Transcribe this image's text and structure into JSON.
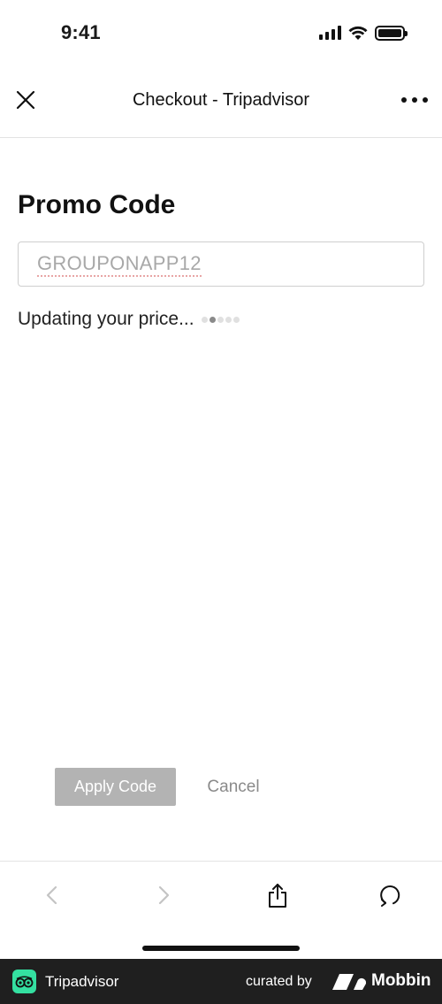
{
  "status_bar": {
    "time": "9:41"
  },
  "header": {
    "title": "Checkout - Tripadvisor"
  },
  "main": {
    "title": "Promo Code",
    "promo_input": {
      "value": "GROUPONAPP12"
    },
    "status_text": "Updating your price..."
  },
  "actions": {
    "apply_label": "Apply Code",
    "cancel_label": "Cancel"
  },
  "footer": {
    "app_name": "Tripadvisor",
    "curated_by": "curated by",
    "brand": "Mobbin"
  },
  "colors": {
    "accent": "#34e0a1",
    "button_disabled": "#b3b3b3"
  }
}
